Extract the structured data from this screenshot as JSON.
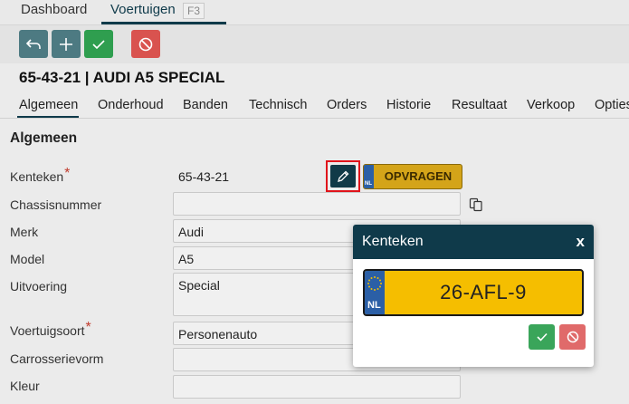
{
  "top_tabs": [
    {
      "label": "Dashboard"
    },
    {
      "label": "Voertuigen",
      "shortcut": "F3"
    }
  ],
  "toolbar": {
    "back_icon": "undo-arrow-icon",
    "add_icon": "plus-icon",
    "save_icon": "check-icon",
    "cancel_icon": "block-icon"
  },
  "title": "65-43-21 | AUDI A5 SPECIAL",
  "section_tabs": [
    "Algemeen",
    "Onderhoud",
    "Banden",
    "Technisch",
    "Orders",
    "Historie",
    "Resultaat",
    "Verkoop",
    "Opties"
  ],
  "section_title": "Algemeen",
  "form": {
    "kenteken": {
      "label": "Kenteken",
      "required": "*",
      "value": "65-43-21"
    },
    "opvragen_label": "OPVRAGEN",
    "opvragen_badge": "NL",
    "chassisnummer": {
      "label": "Chassisnummer",
      "value": ""
    },
    "merk": {
      "label": "Merk",
      "value": "Audi"
    },
    "model": {
      "label": "Model",
      "value": "A5"
    },
    "uitvoering": {
      "label": "Uitvoering",
      "value": "Special"
    },
    "voertuigsoort": {
      "label": "Voertuigsoort",
      "required": "*",
      "value": "Personenauto"
    },
    "carrosserievorm": {
      "label": "Carrosserievorm",
      "value": ""
    },
    "kleur": {
      "label": "Kleur",
      "value": ""
    }
  },
  "modal": {
    "title": "Kenteken",
    "close": "x",
    "country": "NL",
    "plate_value": "26-AFL-9"
  },
  "colors": {
    "header": "#0f3a4a",
    "plate_yellow": "#f5be00",
    "eu_blue": "#2b5fa6",
    "confirm_green": "#3aa55a",
    "cancel_red": "#e06a6a"
  }
}
